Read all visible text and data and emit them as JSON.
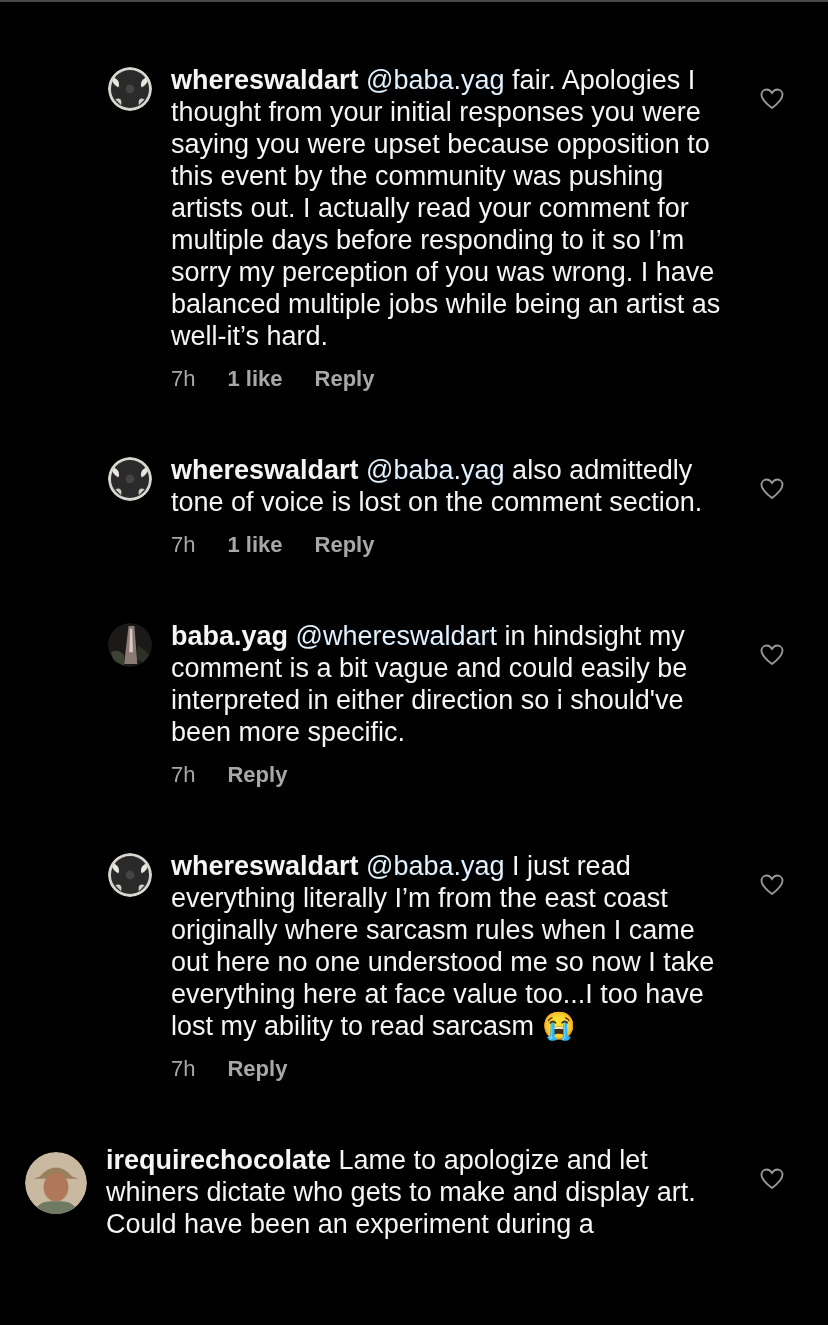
{
  "comments": [
    {
      "kind": "reply",
      "username": "whereswaldart",
      "mention": "@baba.yag",
      "text": "fair. Apologies I thought from your initial responses you were saying you were upset because opposition to this event by the community was pushing artists out. I actually read your comment for multiple days before responding to it so I’m sorry my perception of you was wrong. I have balanced multiple jobs while being an artist as well-it’s hard.",
      "time": "7h",
      "likes": "1 like",
      "reply": "Reply",
      "liked": false
    },
    {
      "kind": "reply",
      "username": "whereswaldart",
      "mention": "@baba.yag",
      "text": "also admittedly tone of voice is lost on the comment section.",
      "time": "7h",
      "likes": "1 like",
      "reply": "Reply",
      "liked": false
    },
    {
      "kind": "reply",
      "username": "baba.yag",
      "mention": "@whereswaldart",
      "text": "in hindsight my comment is a bit vague and could easily be interpreted in either direction so i should've been more specific.",
      "time": "7h",
      "reply": "Reply",
      "liked": false
    },
    {
      "kind": "reply",
      "username": "whereswaldart",
      "mention": "@baba.yag",
      "text": "I just read everything literally I’m from the east coast originally where sarcasm rules when I came out here no one understood me so now I take everything here at face value too...I too have lost my ability to read sarcasm 😭",
      "time": "7h",
      "reply": "Reply",
      "liked": false
    },
    {
      "kind": "top",
      "username": "irequirechocolate",
      "text": "Lame to apologize and let whiners dictate who gets to make and display art. Could have been an experiment during a",
      "liked": false
    }
  ]
}
